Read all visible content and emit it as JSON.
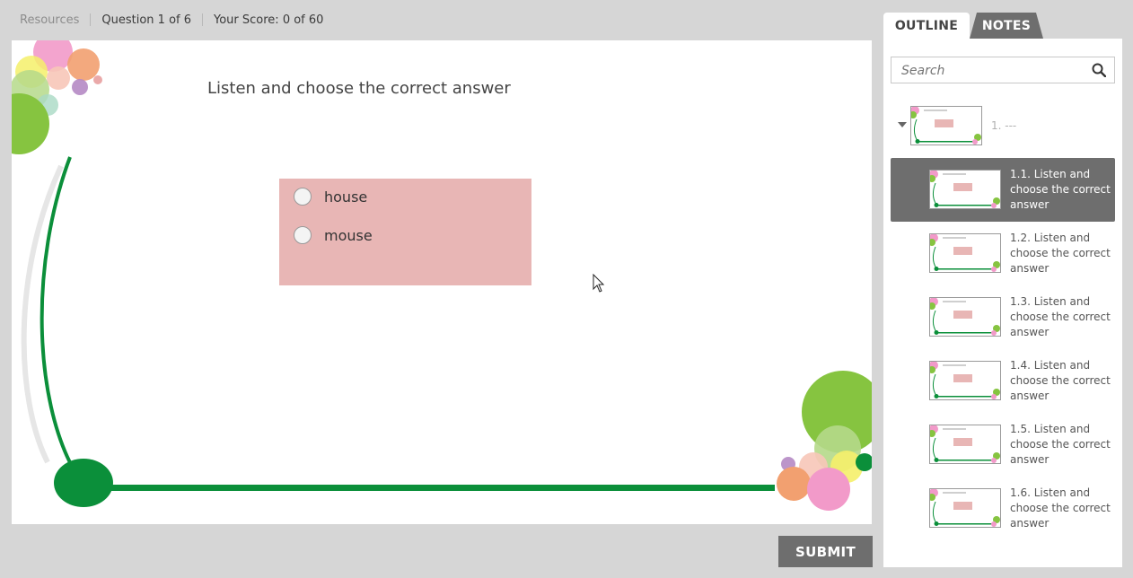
{
  "topbar": {
    "resources": "Resources",
    "question": "Question 1 of 6",
    "score": "Your Score: 0 of 60"
  },
  "slide": {
    "title": "Listen and choose the correct answer",
    "options": [
      "house",
      "mouse"
    ]
  },
  "submit_label": "SUBMIT",
  "sidebar": {
    "tabs": [
      "OUTLINE",
      "NOTES"
    ],
    "search_placeholder": "Search",
    "root_label": "1. ---",
    "items": [
      {
        "label": "1.1. Listen and choose the correct answer",
        "active": true
      },
      {
        "label": "1.2. Listen and choose the correct answer",
        "active": false
      },
      {
        "label": "1.3. Listen and choose the correct answer",
        "active": false
      },
      {
        "label": "1.4. Listen and choose the correct answer",
        "active": false
      },
      {
        "label": "1.5. Listen and choose the correct answer",
        "active": false
      },
      {
        "label": "1.6. Listen and choose the correct answer",
        "active": false
      }
    ]
  },
  "colors": {
    "accent_gray": "#6e6e6e",
    "answer_box": "#e8b6b5",
    "green": "#0b8f3a",
    "lime": "#8cc63f"
  },
  "icons": [
    "search-icon",
    "caret-down-icon",
    "radio-icon",
    "cursor-icon"
  ]
}
